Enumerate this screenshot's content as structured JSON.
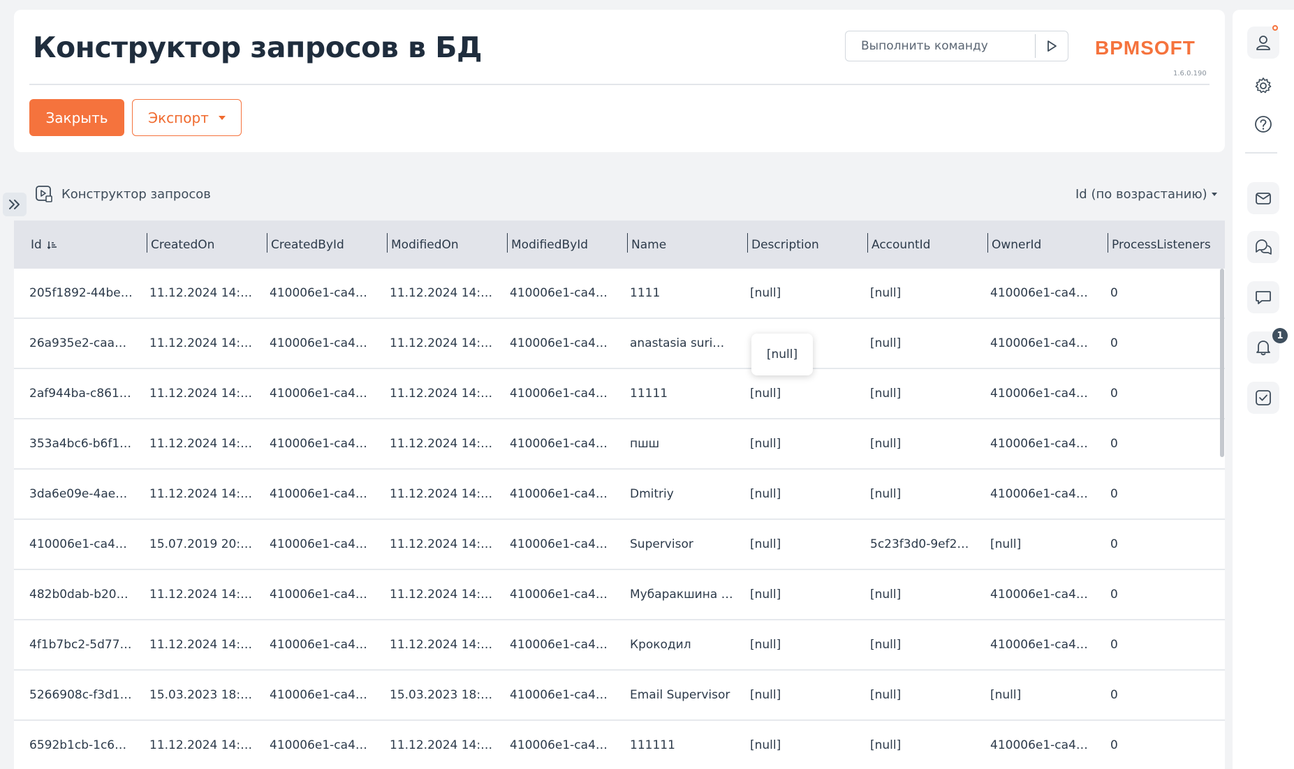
{
  "page": {
    "title": "Конструктор запросов в БД"
  },
  "command": {
    "placeholder": "Выполнить команду"
  },
  "brand": {
    "logo_text": "BPMSOFT",
    "version": "1.6.0.190",
    "accent_color": "#f5733d"
  },
  "toolbar": {
    "close_label": "Закрыть",
    "export_label": "Экспорт"
  },
  "section": {
    "label": "Конструктор запросов",
    "sort_label": "Id (по возрастанию)"
  },
  "table": {
    "columns": [
      "Id",
      "CreatedOn",
      "CreatedById",
      "ModifiedOn",
      "ModifiedById",
      "Name",
      "Description",
      "AccountId",
      "OwnerId",
      "ProcessListeners"
    ],
    "rows": [
      [
        "205f1892-44be…",
        "11.12.2024 14:…",
        "410006e1-ca4…",
        "11.12.2024 14:…",
        "410006e1-ca4…",
        "1111",
        "[null]",
        "[null]",
        "410006e1-ca4…",
        "0"
      ],
      [
        "26a935e2-caa…",
        "11.12.2024 14:…",
        "410006e1-ca4…",
        "11.12.2024 14:…",
        "410006e1-ca4…",
        "anastasia suri…",
        "",
        "[null]",
        "410006e1-ca4…",
        "0"
      ],
      [
        "2af944ba-c861…",
        "11.12.2024 14:…",
        "410006e1-ca4…",
        "11.12.2024 14:…",
        "410006e1-ca4…",
        "11111",
        "[null]",
        "[null]",
        "410006e1-ca4…",
        "0"
      ],
      [
        "353a4bc6-b6f1…",
        "11.12.2024 14:…",
        "410006e1-ca4…",
        "11.12.2024 14:…",
        "410006e1-ca4…",
        "пшш",
        "[null]",
        "[null]",
        "410006e1-ca4…",
        "0"
      ],
      [
        "3da6e09e-4ae…",
        "11.12.2024 14:…",
        "410006e1-ca4…",
        "11.12.2024 14:…",
        "410006e1-ca4…",
        "Dmitriy",
        "[null]",
        "[null]",
        "410006e1-ca4…",
        "0"
      ],
      [
        "410006e1-ca4…",
        "15.07.2019 20:…",
        "410006e1-ca4…",
        "11.12.2024 14:…",
        "410006e1-ca4…",
        "Supervisor",
        "[null]",
        "5c23f3d0-9ef2…",
        "[null]",
        "0"
      ],
      [
        "482b0dab-b20…",
        "11.12.2024 14:…",
        "410006e1-ca4…",
        "11.12.2024 14:…",
        "410006e1-ca4…",
        "Мубаракшина …",
        "[null]",
        "[null]",
        "410006e1-ca4…",
        "0"
      ],
      [
        "4f1b7bc2-5d77…",
        "11.12.2024 14:…",
        "410006e1-ca4…",
        "11.12.2024 14:…",
        "410006e1-ca4…",
        "Крокодил",
        "[null]",
        "[null]",
        "410006e1-ca4…",
        "0"
      ],
      [
        "5266908c-f3d1…",
        "15.03.2023 18:…",
        "410006e1-ca4…",
        "15.03.2023 18:…",
        "410006e1-ca4…",
        "Email Supervisor",
        "[null]",
        "[null]",
        "[null]",
        "0"
      ],
      [
        "6592b1cb-1c6…",
        "11.12.2024 14:…",
        "410006e1-ca4…",
        "11.12.2024 14:…",
        "410006e1-ca4…",
        "111111",
        "[null]",
        "[null]",
        "410006e1-ca4…",
        "0"
      ]
    ]
  },
  "tooltip": {
    "text": "[null]"
  },
  "rail": {
    "notifications_count": "1",
    "icons": [
      "user-icon",
      "gear-icon",
      "help-icon",
      "mail-icon",
      "chat-icon",
      "comment-icon",
      "bell-icon",
      "task-icon"
    ]
  }
}
